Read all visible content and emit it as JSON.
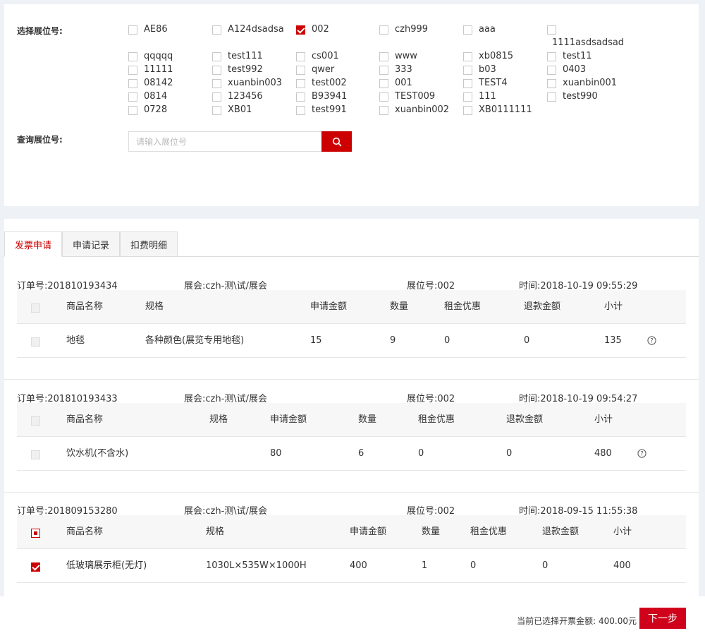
{
  "filter": {
    "select_label": "选择展位号:",
    "query_label": "查询展位号:",
    "search_placeholder": "请输入展位号",
    "booths": [
      {
        "name": "AE86",
        "checked": false
      },
      {
        "name": "A124dsadsa",
        "checked": false
      },
      {
        "name": "002",
        "checked": true
      },
      {
        "name": "czh999",
        "checked": false
      },
      {
        "name": "aaa",
        "checked": false
      },
      {
        "name": "1111asdsadsad",
        "checked": false
      },
      {
        "name": "qqqqq",
        "checked": false
      },
      {
        "name": "test111",
        "checked": false
      },
      {
        "name": "cs001",
        "checked": false
      },
      {
        "name": "www",
        "checked": false
      },
      {
        "name": "xb0815",
        "checked": false
      },
      {
        "name": "test11",
        "checked": false
      },
      {
        "name": "11111",
        "checked": false
      },
      {
        "name": "test992",
        "checked": false
      },
      {
        "name": "qwer",
        "checked": false
      },
      {
        "name": "333",
        "checked": false
      },
      {
        "name": "b03",
        "checked": false
      },
      {
        "name": "0403",
        "checked": false
      },
      {
        "name": "08142",
        "checked": false
      },
      {
        "name": "xuanbin003",
        "checked": false
      },
      {
        "name": "test002",
        "checked": false
      },
      {
        "name": "001",
        "checked": false
      },
      {
        "name": "TEST4",
        "checked": false
      },
      {
        "name": "xuanbin001",
        "checked": false
      },
      {
        "name": "0814",
        "checked": false
      },
      {
        "name": "123456",
        "checked": false
      },
      {
        "name": "B93941",
        "checked": false
      },
      {
        "name": "TEST009",
        "checked": false
      },
      {
        "name": "111",
        "checked": false
      },
      {
        "name": "test990",
        "checked": false
      },
      {
        "name": "0728",
        "checked": false
      },
      {
        "name": "XB01",
        "checked": false
      },
      {
        "name": "test991",
        "checked": false
      },
      {
        "name": "xuanbin002",
        "checked": false
      },
      {
        "name": "XB0111111",
        "checked": false
      }
    ]
  },
  "tabs": [
    {
      "label": "发票申请",
      "active": true
    },
    {
      "label": "申请记录",
      "active": false
    },
    {
      "label": "扣费明细",
      "active": false
    }
  ],
  "orders": [
    {
      "order_no": "订单号:201810193434",
      "expo": "展会:czh-测\\试/展会",
      "booth": "展位号:002",
      "time": "时间:2018-10-19 09:55:29",
      "header": {
        "name": "商品名称",
        "spec": "规格",
        "amount": "申请金额",
        "qty": "数量",
        "discount": "租金优惠",
        "refund": "退款金额",
        "subtotal": "小计"
      },
      "rows": [
        {
          "name": "地毯",
          "spec": "各种颜色(展览专用地毯)",
          "amount": "15",
          "qty": "9",
          "discount": "0",
          "refund": "0",
          "subtotal": "135",
          "selectable": false,
          "checked": false,
          "help": true
        }
      ]
    },
    {
      "order_no": "订单号:201810193433",
      "expo": "展会:czh-测\\试/展会",
      "booth": "展位号:002",
      "time": "时间:2018-10-19 09:54:27",
      "header": {
        "name": "商品名称",
        "spec": "规格",
        "amount": "申请金额",
        "qty": "数量",
        "discount": "租金优惠",
        "refund": "退款金额",
        "subtotal": "小计"
      },
      "rows": [
        {
          "name": "饮水机(不含水)",
          "spec": "",
          "amount": "80",
          "qty": "6",
          "discount": "0",
          "refund": "0",
          "subtotal": "480",
          "selectable": false,
          "checked": false,
          "help": true
        }
      ]
    },
    {
      "order_no": "订单号:201809153280",
      "expo": "展会:czh-测\\试/展会",
      "booth": "展位号:002",
      "time": "时间:2018-09-15 11:55:38",
      "header": {
        "name": "商品名称",
        "spec": "规格",
        "amount": "申请金额",
        "qty": "数量",
        "discount": "租金优惠",
        "refund": "退款金额",
        "subtotal": "小计"
      },
      "rows": [
        {
          "name": "低玻璃展示柜(无灯)",
          "spec": "1030L×535W×1000H",
          "amount": "400",
          "qty": "1",
          "discount": "0",
          "refund": "0",
          "subtotal": "400",
          "selectable": true,
          "checked": true,
          "help": false
        }
      ]
    }
  ],
  "footer": {
    "total_text": "当前已选择开票金额: 400.00元",
    "next_label": "下一步"
  },
  "colors": {
    "accent": "#cc0000",
    "next_button": "#d0021b"
  }
}
